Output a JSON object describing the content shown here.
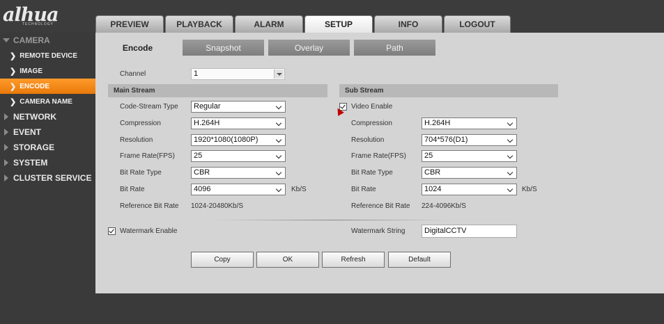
{
  "brand": {
    "logo": "alhua",
    "logo_sub": "TECHNOLOGY"
  },
  "topnav": [
    "PREVIEW",
    "PLAYBACK",
    "ALARM",
    "SETUP",
    "INFO",
    "LOGOUT"
  ],
  "topnav_active": "SETUP",
  "sidebar": {
    "camera": "CAMERA",
    "camera_items": [
      "REMOTE DEVICE",
      "IMAGE",
      "ENCODE",
      "CAMERA NAME"
    ],
    "active_item": "ENCODE",
    "sections": [
      "NETWORK",
      "EVENT",
      "STORAGE",
      "SYSTEM",
      "CLUSTER SERVICE"
    ]
  },
  "subtabs": [
    "Encode",
    "Snapshot",
    "Overlay",
    "Path"
  ],
  "subtab_active": "Encode",
  "channel": {
    "label": "Channel",
    "value": "1"
  },
  "main_stream": {
    "title": "Main Stream",
    "code_stream_type": {
      "label": "Code-Stream Type",
      "value": "Regular"
    },
    "compression": {
      "label": "Compression",
      "value": "H.264H"
    },
    "resolution": {
      "label": "Resolution",
      "value": "1920*1080(1080P)"
    },
    "frame_rate": {
      "label": "Frame Rate(FPS)",
      "value": "25"
    },
    "bit_rate_type": {
      "label": "Bit Rate Type",
      "value": "CBR"
    },
    "bit_rate": {
      "label": "Bit Rate",
      "value": "4096",
      "unit": "Kb/S"
    },
    "reference_bit_rate": {
      "label": "Reference Bit Rate",
      "value": "1024-20480Kb/S"
    }
  },
  "sub_stream": {
    "title": "Sub Stream",
    "video_enable": {
      "label": "Video Enable",
      "checked": true
    },
    "compression": {
      "label": "Compression",
      "value": "H.264H"
    },
    "resolution": {
      "label": "Resolution",
      "value": "704*576(D1)"
    },
    "frame_rate": {
      "label": "Frame Rate(FPS)",
      "value": "25"
    },
    "bit_rate_type": {
      "label": "Bit Rate Type",
      "value": "CBR"
    },
    "bit_rate": {
      "label": "Bit Rate",
      "value": "1024",
      "unit": "Kb/S"
    },
    "reference_bit_rate": {
      "label": "Reference Bit Rate",
      "value": "224-4096Kb/S"
    }
  },
  "watermark": {
    "enable_label": "Watermark Enable",
    "enable_checked": true,
    "string_label": "Watermark String",
    "string_value": "DigitalCCTV"
  },
  "buttons": {
    "copy": "Copy",
    "ok": "OK",
    "refresh": "Refresh",
    "default": "Default"
  },
  "colors": {
    "accent": "#f08a1a",
    "panel": "#d4d4d4",
    "chrome": "#3a3a3a"
  }
}
